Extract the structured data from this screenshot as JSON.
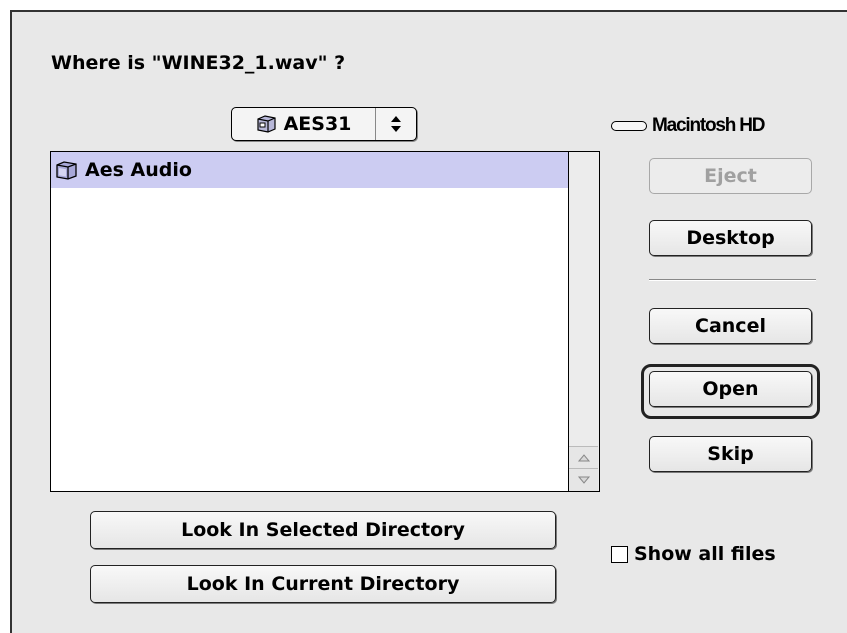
{
  "dialog": {
    "prompt": "Where is \"WINE32_1.wav\" ?"
  },
  "folder_popup": {
    "selected": "AES31",
    "icon": "folder-network-icon"
  },
  "volume": {
    "name": "Macintosh HD",
    "icon": "hard-disk-icon"
  },
  "file_list": {
    "items": [
      {
        "label": "Aes Audio",
        "icon": "folder-icon",
        "selected": true
      }
    ]
  },
  "buttons": {
    "eject": "Eject",
    "desktop": "Desktop",
    "cancel": "Cancel",
    "open": "Open",
    "skip": "Skip",
    "look_selected": "Look In Selected Directory",
    "look_current": "Look In Current Directory"
  },
  "options": {
    "show_all_files": "Show all files",
    "show_all_checked": false
  },
  "colors": {
    "selection": "#ccccf2",
    "dialog_bg": "#e8e8e8"
  }
}
